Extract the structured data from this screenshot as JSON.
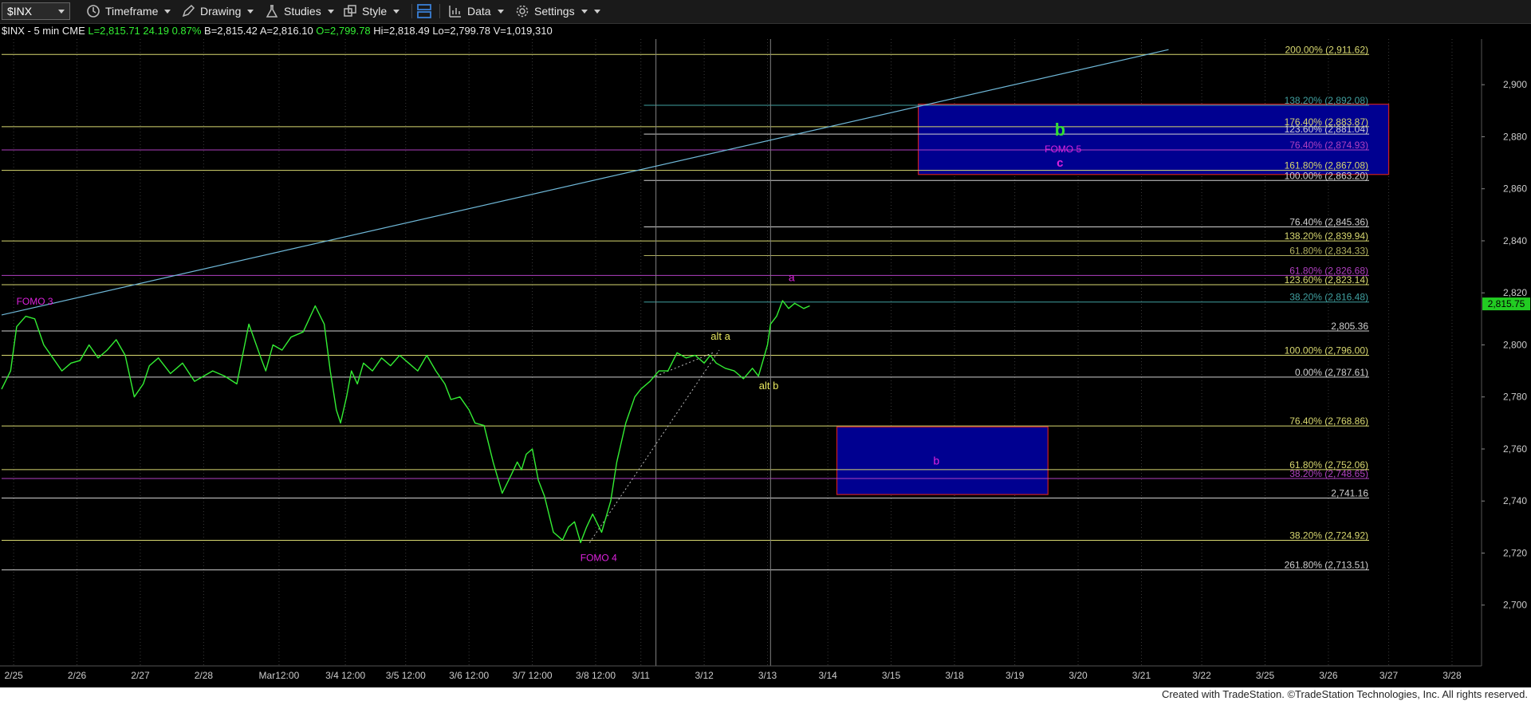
{
  "toolbar": {
    "symbol": "$INX",
    "timeframe": "Timeframe",
    "drawing": "Drawing",
    "studies": "Studies",
    "style": "Style",
    "data": "Data",
    "settings": "Settings"
  },
  "footer": "Created with TradeStation. ©TradeStation Technologies, Inc. All rights reserved.",
  "colors": {
    "background": "#000000",
    "price": "#33ee33",
    "grid": "#3a3a3a",
    "fib_yellow": "#d8d870",
    "fib_white": "#d0d0d0",
    "fib_purple": "#b040c0",
    "fib_teal": "#40a0a0",
    "box_fill": "#000090",
    "box_border": "#cc2020",
    "label_magenta": "#dd22dd",
    "label_yellow": "#e8e860",
    "trendline": "#6fb8d8"
  },
  "chart_data": {
    "type": "line",
    "header": {
      "symbol": "$INX - 5 min",
      "exchange": "CME",
      "last": "L=2,815.71",
      "change": "24.19",
      "pct": "0.87%",
      "bid": "B=2,815.42",
      "ask": "A=2,816.10",
      "open": "O=2,799.78",
      "high": "Hi=2,818.49",
      "low": "Lo=2,799.78",
      "volume": "V=1,019,310"
    },
    "last_price_tag": "2,815.75",
    "ylim": [
      2680,
      2916
    ],
    "yticks": [
      2700,
      2720,
      2740,
      2760,
      2780,
      2800,
      2820,
      2840,
      2860,
      2880,
      2900
    ],
    "ytick_labels": [
      "2,700",
      "2,720",
      "2,740",
      "2,760",
      "2,780",
      "2,800",
      "2,820",
      "2,840",
      "2,860",
      "2,880",
      "2,900"
    ],
    "xlim": [
      0,
      24.5
    ],
    "xticks": [
      {
        "x": 0.2,
        "label": "2/25"
      },
      {
        "x": 1.25,
        "label": "2/26"
      },
      {
        "x": 2.3,
        "label": "2/27"
      },
      {
        "x": 3.35,
        "label": "2/28"
      },
      {
        "x": 4.6,
        "label": "Mar12:00"
      },
      {
        "x": 5.7,
        "label": "3/4 12:00"
      },
      {
        "x": 6.7,
        "label": "3/5 12:00"
      },
      {
        "x": 7.75,
        "label": "3/6 12:00"
      },
      {
        "x": 8.8,
        "label": "3/7 12:00"
      },
      {
        "x": 9.85,
        "label": "3/8 12:00"
      },
      {
        "x": 10.6,
        "label": "3/11"
      },
      {
        "x": 11.65,
        "label": "3/12"
      },
      {
        "x": 12.7,
        "label": "3/13"
      },
      {
        "x": 13.7,
        "label": "3/14"
      },
      {
        "x": 14.75,
        "label": "3/15"
      },
      {
        "x": 15.8,
        "label": "3/18"
      },
      {
        "x": 16.8,
        "label": "3/19"
      },
      {
        "x": 17.85,
        "label": "3/20"
      },
      {
        "x": 18.9,
        "label": "3/21"
      },
      {
        "x": 19.9,
        "label": "3/22"
      },
      {
        "x": 20.95,
        "label": "3/25"
      },
      {
        "x": 22.0,
        "label": "3/26"
      },
      {
        "x": 23.0,
        "label": "3/27"
      },
      {
        "x": 24.05,
        "label": "3/28"
      }
    ],
    "series": [
      {
        "x": [
          0,
          0.15,
          0.25,
          0.4,
          0.55,
          0.7,
          0.85,
          1.0,
          1.15,
          1.3,
          1.45,
          1.6,
          1.75,
          1.9,
          2.05,
          2.2,
          2.35,
          2.45,
          2.6,
          2.8,
          3.0,
          3.2,
          3.35,
          3.5,
          3.7,
          3.9,
          4.1,
          4.3,
          4.38,
          4.5,
          4.65,
          4.8,
          5.0,
          5.2,
          5.35,
          5.45,
          5.55,
          5.62,
          5.72,
          5.8,
          5.9,
          6.0,
          6.15,
          6.3,
          6.45,
          6.6,
          6.75,
          6.9,
          7.05,
          7.2,
          7.35,
          7.45,
          7.6,
          7.75,
          7.85,
          8.0,
          8.15,
          8.3,
          8.45,
          8.55,
          8.62,
          8.7,
          8.8,
          8.9,
          9.0,
          9.15,
          9.3,
          9.4,
          9.5,
          9.6,
          9.7,
          9.8,
          9.95,
          10.1,
          10.2,
          10.35,
          10.5,
          10.6,
          10.75,
          10.9,
          11.05,
          11.2,
          11.35,
          11.5,
          11.65,
          11.75,
          11.85,
          12.0,
          12.15,
          12.3,
          12.45,
          12.55,
          12.65,
          12.7,
          12.75,
          12.85,
          12.95,
          13.05,
          13.15,
          13.3,
          13.4
        ],
        "y": [
          2783,
          2790,
          2807,
          2811,
          2810,
          2800,
          2795,
          2790,
          2793,
          2794,
          2800,
          2795,
          2798,
          2802,
          2796,
          2780,
          2785,
          2792,
          2795,
          2789,
          2793,
          2786,
          2788,
          2790,
          2788,
          2785,
          2808,
          2795,
          2790,
          2800,
          2798,
          2803,
          2805,
          2815,
          2808,
          2790,
          2775,
          2770,
          2780,
          2790,
          2785,
          2793,
          2790,
          2795,
          2792,
          2796,
          2793,
          2790,
          2796,
          2790,
          2785,
          2779,
          2780,
          2775,
          2770,
          2769,
          2755,
          2743,
          2750,
          2755,
          2752,
          2758,
          2760,
          2748,
          2742,
          2728,
          2725,
          2730,
          2732,
          2724,
          2730,
          2735,
          2728,
          2740,
          2755,
          2770,
          2780,
          2783,
          2786,
          2790,
          2790,
          2797,
          2795,
          2796,
          2793,
          2796,
          2793,
          2791,
          2790,
          2787,
          2791,
          2788,
          2796,
          2800,
          2808,
          2811,
          2817,
          2814,
          2816,
          2814,
          2815
        ]
      }
    ],
    "fib_levels": [
      {
        "value": 2911.62,
        "label": "200.00% (2,911.62)",
        "color": "#d8d870",
        "x0": 0
      },
      {
        "value": 2892.08,
        "label": "138.20% (2,892.08)",
        "color": "#40a0a0",
        "x0": 10.65
      },
      {
        "value": 2883.87,
        "label": "176.40% (2,883.87)",
        "color": "#d8d870",
        "x0": 0
      },
      {
        "value": 2881.04,
        "label": "123.60% (2,881.04)",
        "color": "#d0d0d0",
        "x0": 10.65
      },
      {
        "value": 2874.93,
        "label": "76.40% (2,874.93)",
        "color": "#b040c0",
        "x0": 0
      },
      {
        "value": 2867.08,
        "label": "161.80% (2,867.08)",
        "color": "#d8d870",
        "x0": 0
      },
      {
        "value": 2863.2,
        "label": "100.00% (2,863.20)",
        "color": "#d0d0d0",
        "x0": 10.65
      },
      {
        "value": 2845.36,
        "label": "76.40% (2,845.36)",
        "color": "#d0d0d0",
        "x0": 10.65
      },
      {
        "value": 2839.94,
        "label": "138.20% (2,839.94)",
        "color": "#d8d870",
        "x0": 0
      },
      {
        "value": 2834.33,
        "label": "61.80% (2,834.33)",
        "color": "#b0b060",
        "x0": 10.65
      },
      {
        "value": 2826.68,
        "label": "61.80% (2,826.68)",
        "color": "#b040c0",
        "x0": 0
      },
      {
        "value": 2823.14,
        "label": "123.60% (2,823.14)",
        "color": "#d8d870",
        "x0": 0
      },
      {
        "value": 2816.48,
        "label": "38.20% (2,816.48)",
        "color": "#40a0a0",
        "x0": 10.65
      },
      {
        "value": 2805.36,
        "label": "2,805.36",
        "color": "#d0d0d0",
        "x0": 0
      },
      {
        "value": 2796.0,
        "label": "100.00% (2,796.00)",
        "color": "#d8d870",
        "x0": 0
      },
      {
        "value": 2787.61,
        "label": "0.00% (2,787.61)",
        "color": "#d0d0d0",
        "x0": 0
      },
      {
        "value": 2768.86,
        "label": "76.40% (2,768.86)",
        "color": "#d8d870",
        "x0": 0
      },
      {
        "value": 2752.06,
        "label": "61.80% (2,752.06)",
        "color": "#d8d870",
        "x0": 0
      },
      {
        "value": 2748.65,
        "label": "38.20% (2,748.65)",
        "color": "#b040c0",
        "x0": 0
      },
      {
        "value": 2741.16,
        "label": "2,741.16",
        "color": "#d0d0d0",
        "x0": 0
      },
      {
        "value": 2724.92,
        "label": "38.20% (2,724.92)",
        "color": "#d8d870",
        "x0": 0
      },
      {
        "value": 2713.51,
        "label": "261.80% (2,713.51)",
        "color": "#d0d0d0",
        "x0": 0
      }
    ],
    "target_boxes": [
      {
        "x0": 15.2,
        "x1": 23.0,
        "y0": 2865.5,
        "y1": 2892.5,
        "label": "b",
        "label2": "c",
        "note": "FOMO 5"
      },
      {
        "x0": 13.85,
        "x1": 17.35,
        "y0": 2742.5,
        "y1": 2768.5,
        "label": "b"
      }
    ],
    "trendline": {
      "x0": 0,
      "y0": 2811.5,
      "x1": 19.35,
      "y1": 2913.5
    },
    "vlines": [
      10.85,
      12.75
    ],
    "dotted_lines": [
      {
        "x0": 9.75,
        "y0": 2724,
        "x1": 11.9,
        "y1": 2798
      },
      {
        "x0": 10.85,
        "y0": 2788,
        "x1": 11.8,
        "y1": 2797
      }
    ],
    "annotations": [
      {
        "text": "FOMO 3",
        "x": 0.55,
        "y": 2815.5,
        "color": "#dd22dd",
        "size": 12
      },
      {
        "text": "FOMO 4",
        "x": 9.9,
        "y": 2717,
        "color": "#dd22dd",
        "size": 12
      },
      {
        "text": "alt a",
        "x": 11.92,
        "y": 2802,
        "color": "#e8e860",
        "size": 13
      },
      {
        "text": "alt b",
        "x": 12.72,
        "y": 2783,
        "color": "#e8e860",
        "size": 13
      },
      {
        "text": "a",
        "x": 13.1,
        "y": 2824.5,
        "color": "#dd22dd",
        "size": 14
      },
      {
        "text": "b",
        "x": 17.55,
        "y": 2880.5,
        "color": "#33dd33",
        "size": 22,
        "bold": true
      },
      {
        "text": "FOMO 5",
        "x": 17.6,
        "y": 2874,
        "color": "#dd22dd",
        "size": 12
      },
      {
        "text": "c",
        "x": 17.55,
        "y": 2868.5,
        "color": "#dd22dd",
        "size": 15,
        "bold": true
      },
      {
        "text": "b",
        "x": 15.5,
        "y": 2754,
        "color": "#dd22dd",
        "size": 14
      }
    ]
  }
}
